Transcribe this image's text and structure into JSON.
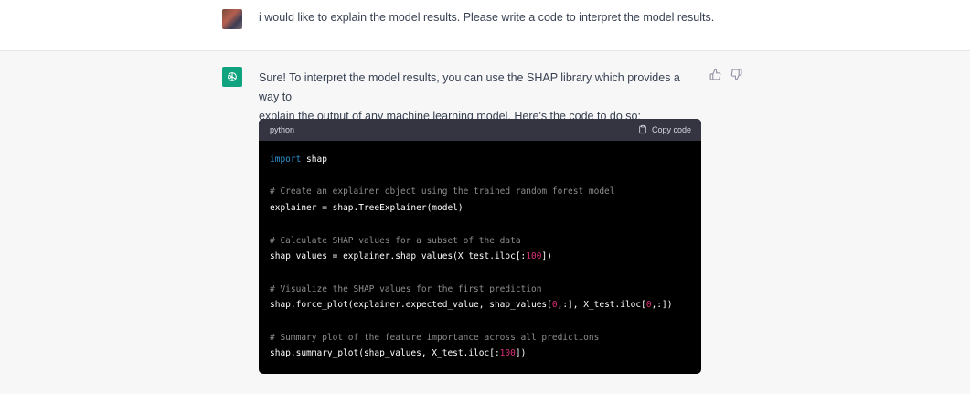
{
  "user": {
    "message": "i would like to explain the model results. Please write a code to interpret the model results."
  },
  "assistant": {
    "line1": "Sure! To interpret the model results, you can use the SHAP library which provides a way to",
    "line2": "explain the output of any machine learning model. Here's the code to do so:"
  },
  "feedback": {
    "thumbs_up": "thumbs-up-icon",
    "thumbs_down": "thumbs-down-icon"
  },
  "code": {
    "language": "python",
    "copy_label": "Copy code",
    "import_kw": "import",
    "import_rest": " shap",
    "comment1": "# Create an explainer object using the trained random forest model",
    "line2": "explainer = shap.TreeExplainer(model)",
    "comment2": "# Calculate SHAP values for a subset of the data",
    "line3_a": "shap_values = explainer.shap_values(X_test.iloc[:",
    "line3_num": "100",
    "line3_b": "])",
    "comment3": "# Visualize the SHAP values for the first prediction",
    "line4_a": "shap.force_plot(explainer.expected_value, shap_values[",
    "line4_num1": "0",
    "line4_b": ",:], X_test.iloc[",
    "line4_num2": "0",
    "line4_c": ",:])",
    "comment4": "# Summary plot of the feature importance across all predictions",
    "line5_a": "shap.summary_plot(shap_values, X_test.iloc[:",
    "line5_num": "100",
    "line5_b": "])"
  },
  "colors": {
    "keyword": "#2e95d3",
    "comment": "#8e8e8e",
    "number": "#df3079",
    "gpt_green": "#10a37f"
  }
}
